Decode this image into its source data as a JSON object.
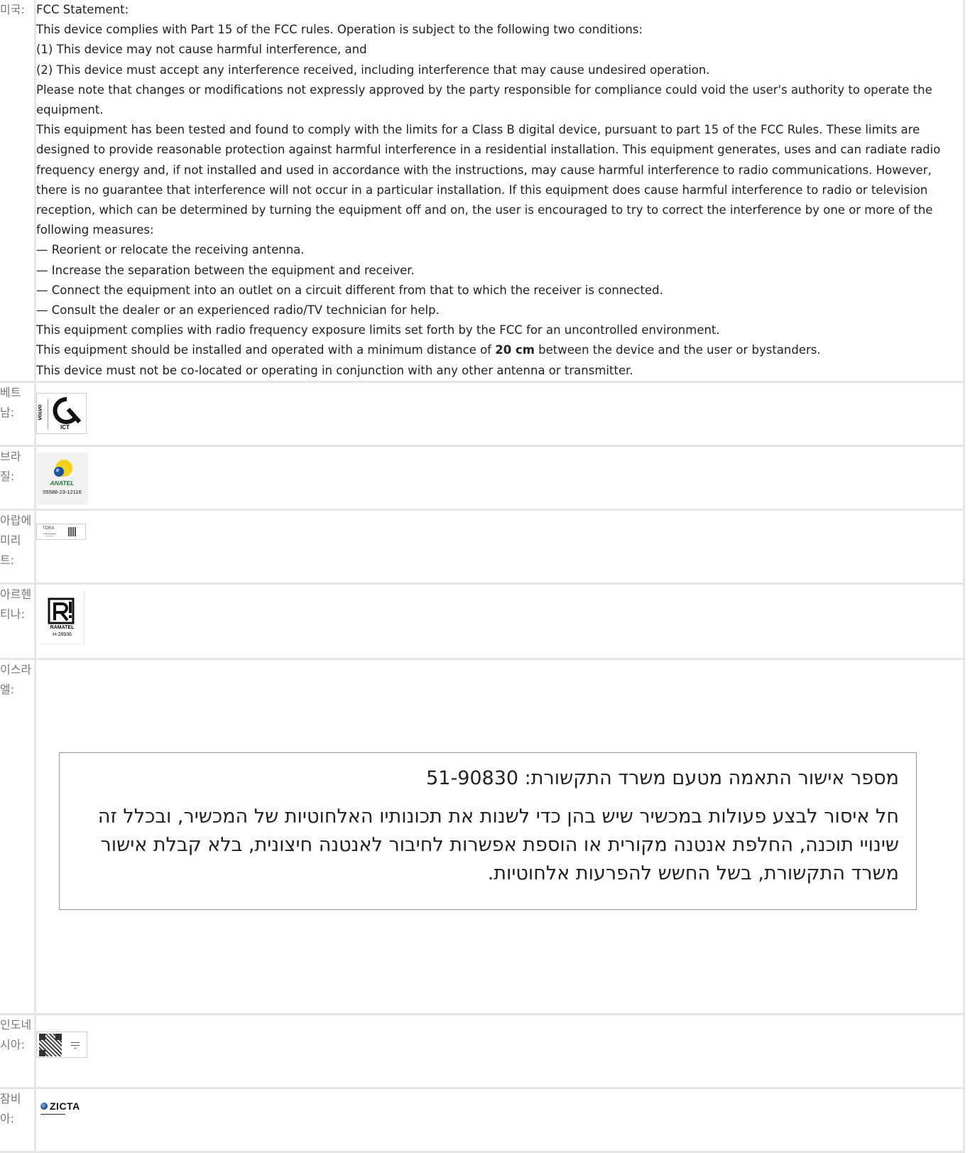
{
  "rows": {
    "usa": {
      "country": "미국:",
      "lines": [
        "FCC Statement:",
        "This device complies with Part 15 of the FCC rules. Operation is subject to the following two conditions:",
        "(1) This device may not cause harmful interference, and",
        "(2) This device must accept any interference received, including interference that may cause undesired operation.",
        "Please note that changes or modifications not expressly approved by the party responsible for compliance could void the user's authority to operate the equipment.",
        "This equipment has been tested and found to comply with the limits for a Class B digital device, pursuant to part 15 of the FCC Rules. These limits are designed to provide reasonable protection against harmful interference in a residential installation. This equipment generates, uses and can radiate radio frequency energy and, if not installed and used in accordance with the instructions, may cause harmful interference to radio communications. However, there is no guarantee that interference will not occur in a particular installation. If this equipment does cause harmful interference to radio or television reception, which can be determined by turning the equipment off and on, the user is encouraged to try to correct the interference by one or more of the following measures:",
        "— Reorient or relocate the receiving antenna.",
        "— Increase the separation between the equipment and receiver.",
        "— Connect the equipment into an outlet on a circuit different from that to which the receiver is connected.",
        "— Consult the dealer or an experienced radio/TV technician for help.",
        "This equipment complies with radio frequency exposure limits set forth by the FCC for an uncontrolled environment."
      ],
      "distance_before": "This equipment should be installed and operated with a minimum distance of ",
      "distance_value": "20 cm",
      "distance_after": " between the device and the user or bystanders.",
      "last_line": "This device must not be co-located or operating in conjunction with any other antenna or transmitter."
    },
    "vietnam": {
      "country": "베트남:",
      "logo_side": "VOLVO",
      "logo_label": "ICT"
    },
    "brazil": {
      "country": "브라질:",
      "logo_name": "ANATEL",
      "logo_number": "05588-23-12116"
    },
    "uae": {
      "country": "아랍에미리트:",
      "logo_name": "TDRA"
    },
    "argentina": {
      "country": "아르헨티나:",
      "logo_name": "RAMATEL",
      "logo_number": "H-28936"
    },
    "israel": {
      "country": "이스라엘:",
      "approval_line": "מספר אישור התאמה מטעם משרד התקשורת: 51-90830",
      "prohibition_text": "חל איסור לבצע פעולות במכשיר שיש בהן כדי לשנות את תכונותיו האלחוטיות של המכשיר, ובכלל זה שינויי תוכנה, החלפת אנטנה מקורית או הוספת אפשרות לחיבור לאנטנה חיצונית, בלא קבלת אישור משרד התקשורת, בשל החשש להפרעות אלחוטיות."
    },
    "indonesia": {
      "country": "인도네시아:"
    },
    "zambia": {
      "country": "잠비아:",
      "logo_name": "ZICTA"
    }
  },
  "colors": {
    "border": "#e6e6e6",
    "country_text": "#777777",
    "anatel_green": "#1a7a2e",
    "anatel_yellow": "#f2d21b",
    "anatel_blue": "#1f4fa0"
  }
}
